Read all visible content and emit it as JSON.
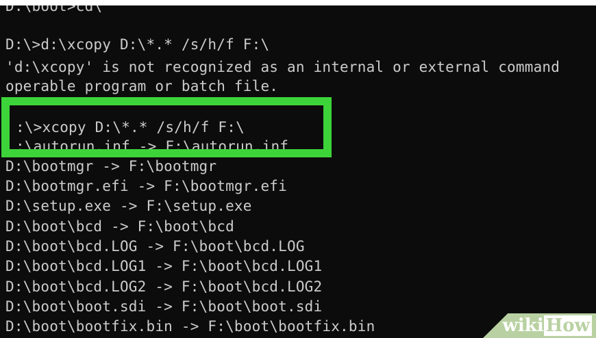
{
  "terminal": {
    "lines": [
      "D:\\boot>cd\\",
      "",
      "D:\\>d:\\xcopy D:\\*.* /s/h/f F:\\",
      "'d:\\xcopy' is not recognized as an internal or external command",
      "operable program or batch file.",
      "",
      ":\\>xcopy D:\\*.* /s/h/f F:\\",
      ":\\autorun.inf -> F:\\autorun.inf",
      "D:\\bootmgr -> F:\\bootmgr",
      "D:\\bootmgr.efi -> F:\\bootmgr.efi",
      "D:\\setup.exe -> F:\\setup.exe",
      "D:\\boot\\bcd -> F:\\boot\\bcd",
      "D:\\boot\\bcd.LOG -> F:\\boot\\bcd.LOG",
      "D:\\boot\\bcd.LOG1 -> F:\\boot\\bcd.LOG1",
      "D:\\boot\\bcd.LOG2 -> F:\\boot\\bcd.LOG2",
      "D:\\boot\\boot.sdi -> F:\\boot\\boot.sdi",
      "D:\\boot\\bootfix.bin -> F:\\boot\\bootfix.bin"
    ]
  },
  "highlight": {
    "color": "#3dd43a"
  },
  "watermark": {
    "part1": "wiki",
    "part2": "How"
  }
}
